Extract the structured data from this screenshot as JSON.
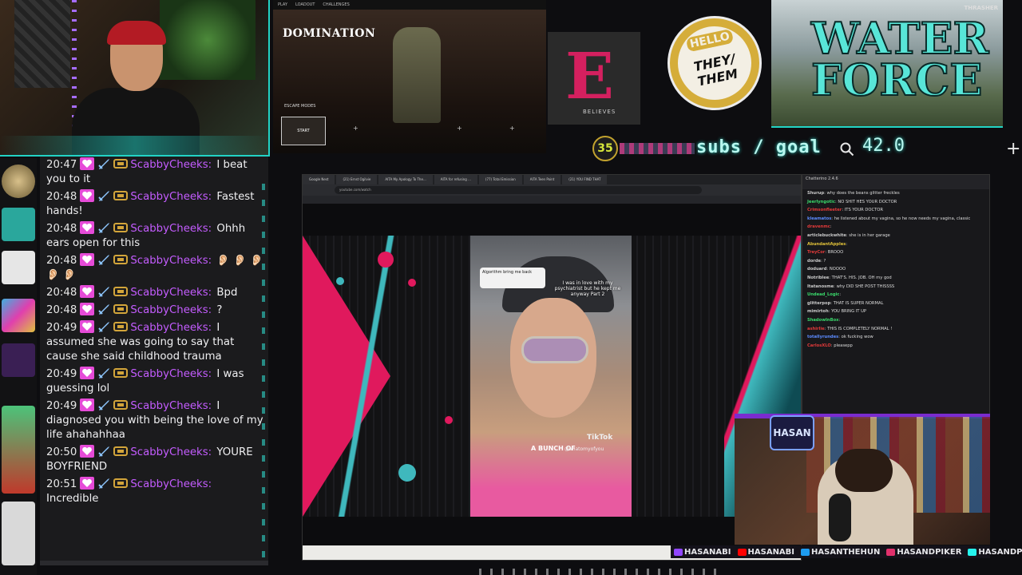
{
  "game": {
    "title": "DOMINATION",
    "start_label": "START",
    "escape_label": "ESCAPE MODES",
    "topbar": [
      "PLAY",
      "LOADOUT",
      "CHALLENGES"
    ]
  },
  "overlay": {
    "logo_letter": "E",
    "logo_caption": "BELIEVES",
    "pronoun_hello": "HELLO",
    "pronoun_my": "My pronouns are",
    "pronoun_value": "THEY/ THEM",
    "graffiti": "WATER FORCE",
    "watermark": "THRASHER"
  },
  "subs": {
    "count": "35",
    "label": "subs / goal",
    "goal": "42.0",
    "plus": "+"
  },
  "chat": {
    "messages": [
      {
        "time": "20:47",
        "user": "ScabbyCheeks:",
        "text": "I beat you to it"
      },
      {
        "time": "20:48",
        "user": "ScabbyCheeks:",
        "text": "Fastest hands!"
      },
      {
        "time": "20:48",
        "user": "ScabbyCheeks:",
        "text": "Ohhh ears open for this"
      },
      {
        "time": "20:48",
        "user": "ScabbyCheeks:",
        "text": "👂🏻 👂🏻 👂🏻 👂🏻 👂🏻"
      },
      {
        "time": "20:48",
        "user": "ScabbyCheeks:",
        "text": "Bpd"
      },
      {
        "time": "20:48",
        "user": "ScabbyCheeks:",
        "text": "?"
      },
      {
        "time": "20:49",
        "user": "ScabbyCheeks:",
        "text": "I assumed she was going to say that cause she said childhood trauma"
      },
      {
        "time": "20:49",
        "user": "ScabbyCheeks:",
        "text": "I was guessing lol"
      },
      {
        "time": "20:49",
        "user": "ScabbyCheeks:",
        "text": "I diagnosed you with being the love of my life ahahahhaa"
      },
      {
        "time": "20:50",
        "user": "ScabbyCheeks:",
        "text": "YOURE BOYFRIEND"
      },
      {
        "time": "20:51",
        "user": "ScabbyCheeks:",
        "text": "Incredible"
      }
    ],
    "colors": {
      "username": "#c45cff",
      "badge_pink": "#e64bd8",
      "badge_gold": "#d3a53a"
    }
  },
  "browser": {
    "tabs": [
      "Google Nest",
      "(21) Ernst Ogilvie",
      "AITA My Apology To The...",
      "AITA for refusing ...",
      "(77) Total Emission",
      "AITA Teen Point",
      "(21) YOU FIND THAT"
    ],
    "url": "youtube.com/watch",
    "tiktok_caption": "I was in love with my psychiatrist but he kept me anyway Part 2",
    "tiktok_reply": "Algorithm bring me back",
    "tiktok_overlay": "A BUNCH OF",
    "tiktok_handle": "@anatomyofyou",
    "tiktok_brand": "TikTok"
  },
  "twitch_chat": {
    "header": "Chatterino 2.4.6",
    "lines": [
      {
        "user": "Shurup",
        "color": "#c9c9c9",
        "text": "why does the beans glitter freckles"
      },
      {
        "user": "Jeerlyngotic",
        "color": "#3ad86b",
        "text": "NO SHIT HES YOUR DOCTOR"
      },
      {
        "user": "Crimsonfleeter",
        "color": "#e23a3a",
        "text": "ITS YOUR DOCTOR"
      },
      {
        "user": "kleamatos",
        "color": "#5c8bff",
        "text": "he listened about my vagina, so he now needs my vagina, classic"
      },
      {
        "user": "dravenmc",
        "color": "#e23a3a",
        "text": ""
      },
      {
        "user": "articlebuckwhite",
        "color": "#c9c9c9",
        "text": "she is in her garage"
      },
      {
        "user": "AbundantApples",
        "color": "#e0c13a",
        "text": ""
      },
      {
        "user": "TreyCor",
        "color": "#e23a3a",
        "text": "BROOO"
      },
      {
        "user": "dorde",
        "color": "#c9c9c9",
        "text": "?"
      },
      {
        "user": "doduard",
        "color": "#c9c9c9",
        "text": "NOOOO"
      },
      {
        "user": "Notriblee",
        "color": "#c9c9c9",
        "text": "THAT'S. HIS. JOB. OH my god"
      },
      {
        "user": "Itatanosme",
        "color": "#c9c9c9",
        "text": "why DID SHE POST THISSSS"
      },
      {
        "user": "Undead_Logic",
        "color": "#3ad86b",
        "text": ""
      },
      {
        "user": "glitterpop",
        "color": "#c9c9c9",
        "text": "THAT IS SUPER NORMAL"
      },
      {
        "user": "mimirtoh",
        "color": "#c9c9c9",
        "text": "YOU BRING IT UP"
      },
      {
        "user": "ShadowInBox",
        "color": "#3ad86b",
        "text": ""
      },
      {
        "user": "ashirlie",
        "color": "#e23a3a",
        "text": "THIS IS COMPLETELY NORMAL !"
      },
      {
        "user": "totallyrundes",
        "color": "#5c8bff",
        "text": "ok fucking wow"
      },
      {
        "user": "CarlosXLO",
        "color": "#e23a3a",
        "text": "pleasepp"
      }
    ]
  },
  "hasan": {
    "logo": "HASAN"
  },
  "socials": [
    {
      "name": "HASANABI",
      "icon_color": "#9146ff"
    },
    {
      "name": "HASANABI",
      "icon_color": "#ff0000"
    },
    {
      "name": "HASANTHEHUN",
      "icon_color": "#1d9bf0"
    },
    {
      "name": "HASANDPIKER",
      "icon_color": "#e1306c"
    },
    {
      "name": "HASANDPIKER",
      "icon_color": "#25f4ee"
    }
  ]
}
